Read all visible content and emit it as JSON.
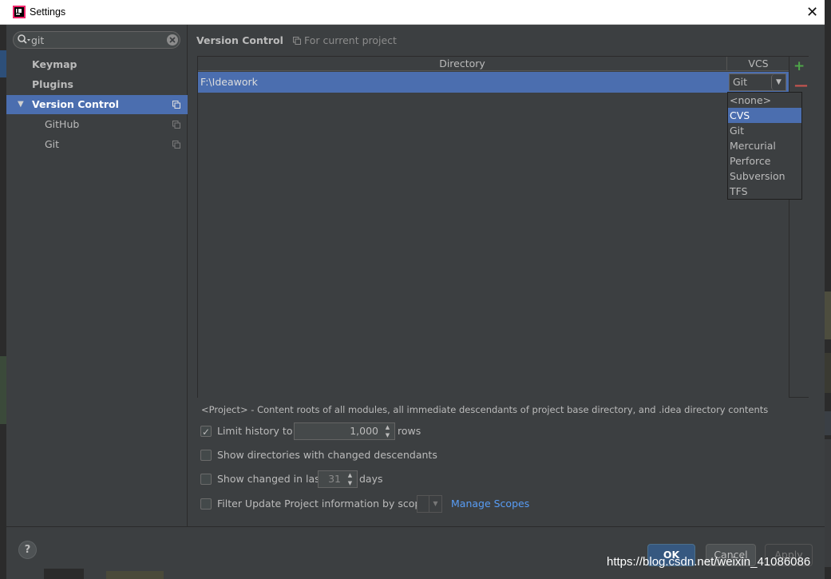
{
  "window": {
    "title": "Settings",
    "close_glyph": "✕",
    "icon": "intellij-icon"
  },
  "sidebar": {
    "search": {
      "value": "git",
      "placeholder": ""
    },
    "items": [
      {
        "label": "Keymap",
        "bold": true
      },
      {
        "label": "Plugins",
        "bold": true
      },
      {
        "label": "Version Control",
        "bold": true,
        "selected": true,
        "expanded": true
      },
      {
        "label": "GitHub",
        "bold": false
      },
      {
        "label": "Git",
        "bold": false
      }
    ]
  },
  "content": {
    "heading": "Version Control",
    "scope_hint": "For current project",
    "table": {
      "columns": [
        "Directory",
        "VCS"
      ],
      "rows": [
        {
          "directory": "F:\\Ideawork",
          "vcs": "Git"
        }
      ]
    },
    "vcs_dropdown": {
      "options": [
        "<none>",
        "CVS",
        "Git",
        "Mercurial",
        "Perforce",
        "Subversion",
        "TFS"
      ],
      "highlighted": "CVS"
    },
    "description": "<Project> - Content roots of all modules, all immediate descendants of project base directory, and .idea directory contents",
    "options": {
      "limit_history": {
        "label": "Limit history to:",
        "checked": true,
        "value": "1,000",
        "suffix": "rows"
      },
      "show_dirs": {
        "label": "Show directories with changed descendants",
        "checked": false
      },
      "show_changed": {
        "label": "Show changed in last",
        "checked": false,
        "value": "31",
        "suffix": "days"
      },
      "filter_update": {
        "label": "Filter Update Project information by scope",
        "checked": false
      },
      "manage_scopes": "Manage Scopes"
    }
  },
  "footer": {
    "help": "?",
    "ok": "OK",
    "cancel": "Cancel",
    "apply": "Apply"
  },
  "watermark": "https://blog.csdn.net/weixin_41086086",
  "colors": {
    "selection": "#4b6eaf",
    "link": "#589df6",
    "add": "#4ea649",
    "remove": "#c75450"
  }
}
